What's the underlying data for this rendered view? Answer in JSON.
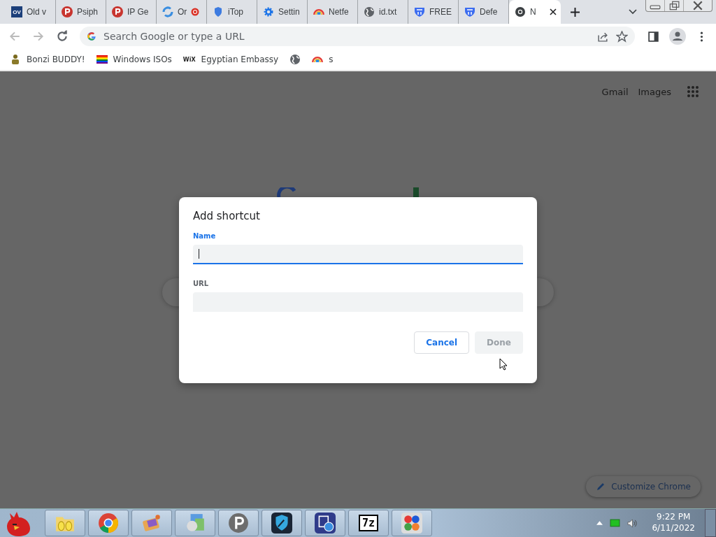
{
  "tabs": [
    {
      "title": "Old v",
      "kind": "ov",
      "badge": "OV",
      "recording": false,
      "selected": false
    },
    {
      "title": "Psiph",
      "kind": "psiphon",
      "recording": false,
      "selected": false
    },
    {
      "title": "IP Ge",
      "kind": "psiphon",
      "recording": false,
      "selected": false
    },
    {
      "title": "Or",
      "kind": "swirl",
      "recording": true,
      "selected": false
    },
    {
      "title": "iTop",
      "kind": "shield",
      "recording": false,
      "selected": false
    },
    {
      "title": "Settin",
      "kind": "gear",
      "recording": false,
      "selected": false
    },
    {
      "title": "Netfe",
      "kind": "rainbow",
      "recording": false,
      "selected": false
    },
    {
      "title": "id.txt",
      "kind": "globe",
      "recording": false,
      "selected": false
    },
    {
      "title": "FREE",
      "kind": "defender",
      "recording": false,
      "selected": false
    },
    {
      "title": "Defe",
      "kind": "defender",
      "recording": false,
      "selected": false
    },
    {
      "title": "N",
      "kind": "chrome",
      "recording": false,
      "selected": true
    }
  ],
  "omnibox": {
    "placeholder": "Search Google or type a URL"
  },
  "bookmarks": [
    {
      "title": "Bonzi BUDDY!",
      "kind": "bonzi"
    },
    {
      "title": "Windows ISOs",
      "kind": "flag"
    },
    {
      "title": "Egyptian Embassy",
      "kind": "wix",
      "badge": "WiX"
    },
    {
      "kind": "globe"
    },
    {
      "title": "s",
      "kind": "rainbow"
    }
  ],
  "header_links": [
    "Gmail",
    "Images"
  ],
  "dialog": {
    "title": "Add shortcut",
    "fields": [
      {
        "label": "Name",
        "focused": true
      },
      {
        "label": "URL",
        "focused": false
      }
    ],
    "buttons": [
      {
        "label": "Cancel",
        "disabled": false
      },
      {
        "label": "Done",
        "disabled": true
      }
    ]
  },
  "customize": {
    "label": "Customize Chrome"
  },
  "taskbar": {
    "apps": [
      {
        "kind": "folder"
      },
      {
        "kind": "chrome"
      },
      {
        "kind": "paint"
      },
      {
        "kind": "photos"
      },
      {
        "kind": "psiphon"
      },
      {
        "kind": "shield"
      },
      {
        "kind": "imageapp"
      },
      {
        "kind": "sevenzip",
        "badge": "7z"
      },
      {
        "kind": "colors"
      }
    ],
    "time": "9:22 PM",
    "date": "6/11/2022"
  }
}
